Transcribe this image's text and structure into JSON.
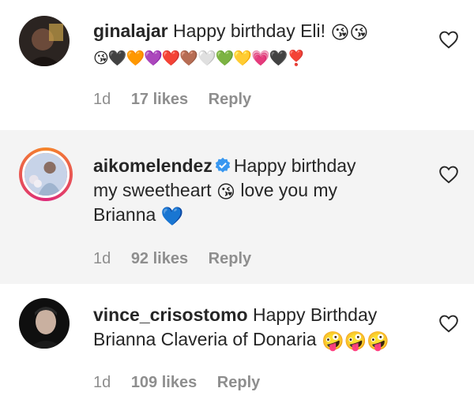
{
  "comments": [
    {
      "username": "ginalajar",
      "text": "Happy birthday Eli!",
      "emoji_line": "😘😘",
      "emoji_line2": "😘🖤🧡💜❤️🤎🤍💚💛💗🖤❣️",
      "time": "1d",
      "likes": "17 likes",
      "reply": "Reply"
    },
    {
      "username": "aikomelendez",
      "text_line1": "Happy birthday",
      "text_line2": "my sweetheart",
      "emoji_mid": "😘",
      "text_line2b": "love you my",
      "text_line3": "Brianna",
      "emoji_end": "💙",
      "time": "1d",
      "likes": "92 likes",
      "reply": "Reply"
    },
    {
      "username": "vince_crisostomo",
      "text_line1": "Happy Birthday",
      "text_line2": "Brianna Claveria of Donaria",
      "emoji_end": "🤪🤪🤪",
      "time": "1d",
      "likes": "109 likes",
      "reply": "Reply"
    }
  ],
  "colors": {
    "text": "#262626",
    "meta": "#8e8e8e",
    "verified": "#3897f0",
    "shaded_bg": "#f4f4f4"
  }
}
